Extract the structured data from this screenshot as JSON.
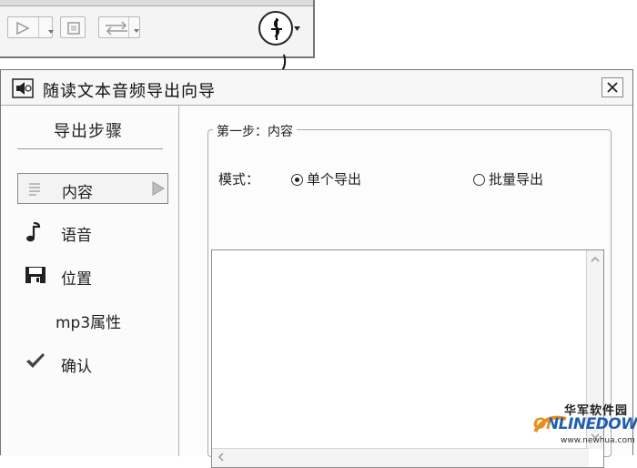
{
  "toolbar": {
    "buttons": [
      {
        "name": "play",
        "icon": "play-icon"
      },
      {
        "name": "stop",
        "icon": "stop-icon"
      },
      {
        "name": "swap",
        "icon": "swap-arrows-icon"
      },
      {
        "name": "export",
        "icon": "export-audio-icon"
      }
    ]
  },
  "dialog": {
    "title": "随读文本音频导出向导",
    "icon": "speaker-icon",
    "close_icon": "close-icon",
    "steps_title": "导出步骤",
    "steps": [
      {
        "label": "内容",
        "icon": "document-icon",
        "selected": true
      },
      {
        "label": "语音",
        "icon": "music-note-icon",
        "selected": false
      },
      {
        "label": "位置",
        "icon": "floppy-disk-icon",
        "selected": false
      },
      {
        "label": "mp3属性",
        "icon": "",
        "selected": false
      },
      {
        "label": "确认",
        "icon": "checkmark-icon",
        "selected": false
      }
    ],
    "group_title": "第一步：内容",
    "mode_label": "模式：",
    "options": [
      {
        "label": "单个导出",
        "selected": true
      },
      {
        "label": "批量导出",
        "selected": false
      }
    ],
    "text_content": ""
  },
  "watermark": {
    "cn": "华军软件园",
    "en": "ONLINEDOWN",
    "url": "www.newhua.com"
  },
  "colors": {
    "watermark_orange": "#e8901c",
    "watermark_blue": "#1f5fb0"
  }
}
